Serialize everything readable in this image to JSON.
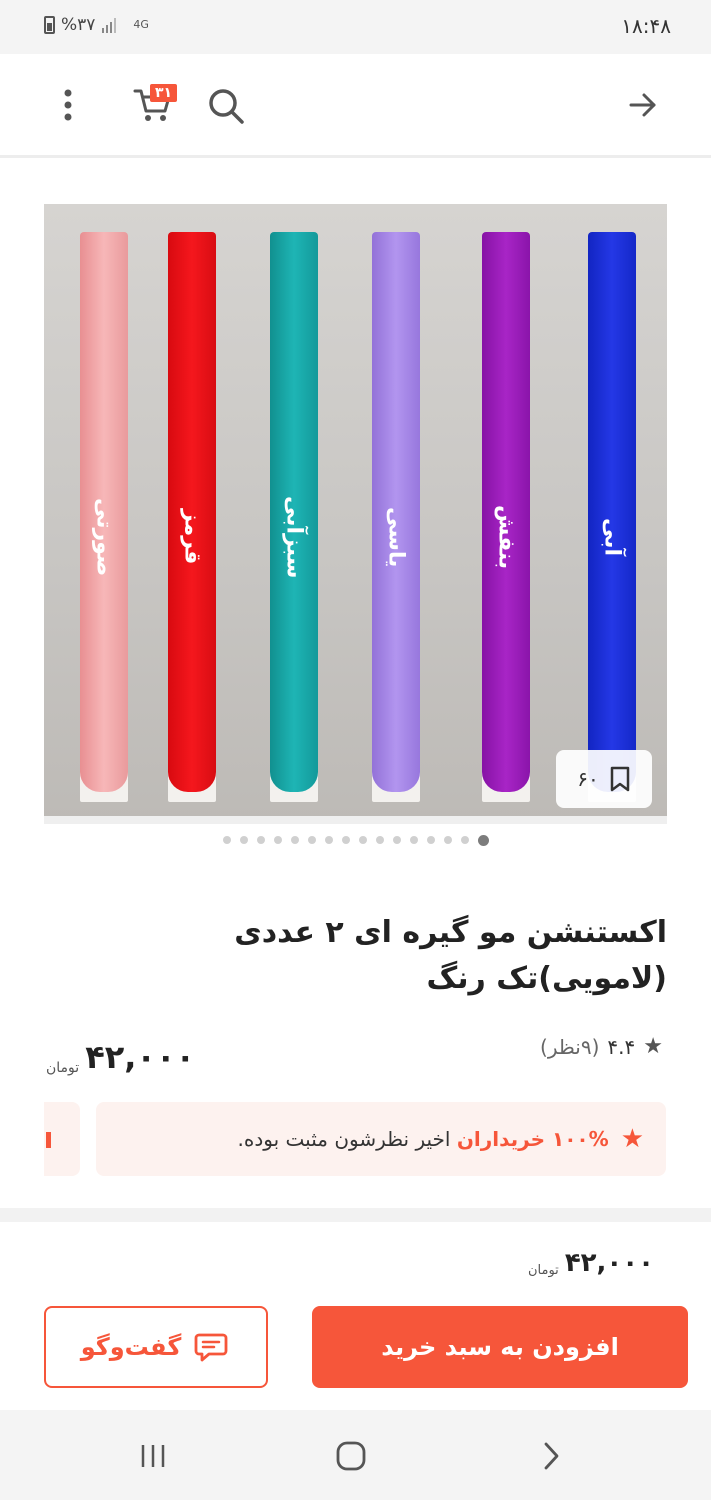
{
  "status_bar": {
    "time": "۱۸:۴۸",
    "battery": "%۳۷",
    "network": "4G"
  },
  "app_bar": {
    "cart_count": "۳۱"
  },
  "gallery": {
    "saved_count": "۶۰",
    "dots_total": 16,
    "active_dot": 16,
    "strips": [
      {
        "label": "صورتی",
        "color": "#f2a5a6"
      },
      {
        "label": "قرمز",
        "color": "#f0141a"
      },
      {
        "label": "سبزآبی",
        "color": "#18a7a8"
      },
      {
        "label": "یاسی",
        "color": "#a585e6"
      },
      {
        "label": "بنفش",
        "color": "#9a1bb9"
      },
      {
        "label": "آبی",
        "color": "#1a2fd8"
      }
    ]
  },
  "product": {
    "title": "اکستنشن مو گیره ای ۲ عددی (لامویی)تک رنگ",
    "rating_value": "۴.۴",
    "rating_count": "(۹نظر)",
    "price": "۴۲,۰۰۰",
    "currency": "تومان"
  },
  "promo": {
    "accent_text": "۱۰۰% خریداران",
    "rest_text": "اخیر نظرشون مثبت بوده."
  },
  "bottom": {
    "price": "۴۲,۰۰۰",
    "currency": "تومان",
    "add_to_cart_label": "افزودن به سبد خرید",
    "chat_label": "گفت‌وگو"
  },
  "colors": {
    "accent": "#f6563a",
    "promo_bg": "#fdf2ef"
  }
}
